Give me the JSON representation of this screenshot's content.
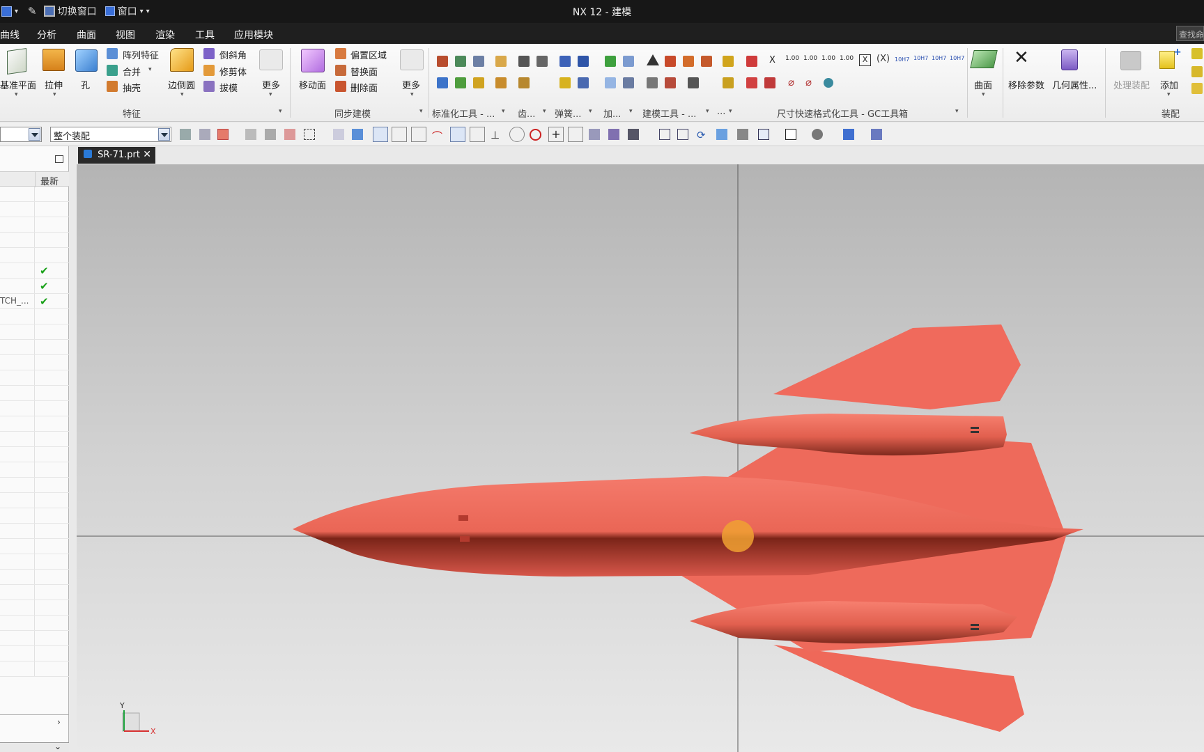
{
  "window": {
    "title": "NX 12 - 建模",
    "quick_access": {
      "switch_window": "切换窗口",
      "window_menu": "窗口"
    }
  },
  "menu": [
    "曲线",
    "分析",
    "曲面",
    "视图",
    "渲染",
    "工具",
    "应用模块"
  ],
  "search": {
    "placeholder": "查找命"
  },
  "ribbon": {
    "feature_group": {
      "label": "特征",
      "datum_plane": "基准平面",
      "extrude": "拉伸",
      "hole": "孔",
      "pattern": "阵列特征",
      "unite": "合并",
      "shell": "抽壳",
      "edge_blend": "边倒圆",
      "chamfer": "倒斜角",
      "trim_body": "修剪体",
      "draft": "拔模",
      "more": "更多"
    },
    "sync_group": {
      "label": "同步建模",
      "move_face": "移动面",
      "offset_region": "偏置区域",
      "replace_face": "替换面",
      "delete_face": "删除面",
      "more": "更多"
    },
    "standard_tools": "标准化工具 - ...",
    "gear": "齿...",
    "spring": "弹簧...",
    "add": "加...",
    "modeling_tools": "建模工具 - ...",
    "extra": "...",
    "dim_toolbox": "尺寸快速格式化工具 - GC工具箱",
    "dim_buttons": [
      "X",
      "1.00",
      "1.00",
      "1.00",
      "1.00"
    ],
    "dim_fit": [
      "10H7",
      "10H7",
      "10H7",
      "10H7"
    ],
    "surface": "曲面",
    "remove_params": "移除参数",
    "geometry_props": "几何属性...",
    "process_assembly": "处理装配",
    "add_component": "添加",
    "assembly_label": "装配"
  },
  "selection_bar": {
    "filter_value": "",
    "scope_value": "整个装配"
  },
  "navigator": {
    "header_latest": "最新",
    "rows": [
      {
        "text": "",
        "check": false
      },
      {
        "text": "",
        "check": false
      },
      {
        "text": "",
        "check": false
      },
      {
        "text": "",
        "check": false
      },
      {
        "text": "",
        "check": false
      },
      {
        "text": "",
        "check": true
      },
      {
        "text": "",
        "check": true
      },
      {
        "text": "TCH_...",
        "check": true
      }
    ]
  },
  "document_tab": {
    "label": "SR-71.prt"
  },
  "triad": {
    "y": "Y",
    "x": "X"
  },
  "colors": {
    "model": "#f06a5c",
    "titlebar": "#171717",
    "check": "#19a119"
  }
}
